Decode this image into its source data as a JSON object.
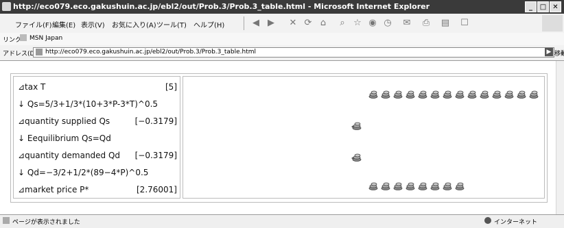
{
  "window": {
    "title": "http://eco079.eco.gakushuin.ac.jp/ebl2/out/Prob.3/Prob.3_table.html - Microsoft Internet Explorer"
  },
  "menu": [
    "ファイル(F)",
    "編集(E)",
    "表示(V)",
    "お気に入り(A)",
    "ツール(T)",
    "ヘルプ(H)"
  ],
  "toolbar": [
    "back-icon",
    "forward-icon",
    "stop-icon",
    "refresh-icon",
    "home-icon",
    "search-icon",
    "favorites-icon",
    "media-icon",
    "history-icon",
    "mail-icon",
    "print-icon",
    "edit-icon",
    "discuss-icon"
  ],
  "links": {
    "label": "リンク",
    "item": "MSN Japan"
  },
  "address": {
    "label": "アドレス(D)",
    "url": "http://eco079.eco.gakushuin.ac.jp/ebl2/out/Prob.3/Prob.3_table.html",
    "go": "移動"
  },
  "rows": [
    {
      "label": "⊿tax T",
      "value": "[5]"
    },
    {
      "label": "↓ Qs=5/3+1/3*(10+3*P-3*T)^0.5",
      "value": ""
    },
    {
      "label": "⊿quantity supplied Qs",
      "value": "[−0.3179]"
    },
    {
      "label": "↓ Eequilibrium Qs=Qd",
      "value": ""
    },
    {
      "label": "⊿quantity demanded Qd",
      "value": "[−0.3179]"
    },
    {
      "label": "↓ Qd=−3/2+1/2*(89−4*P)^0.5",
      "value": ""
    },
    {
      "label": "⊿market price P*",
      "value": "[2.76001]"
    }
  ],
  "status": {
    "text": "ページが表示されました",
    "zone": "インターネット"
  }
}
